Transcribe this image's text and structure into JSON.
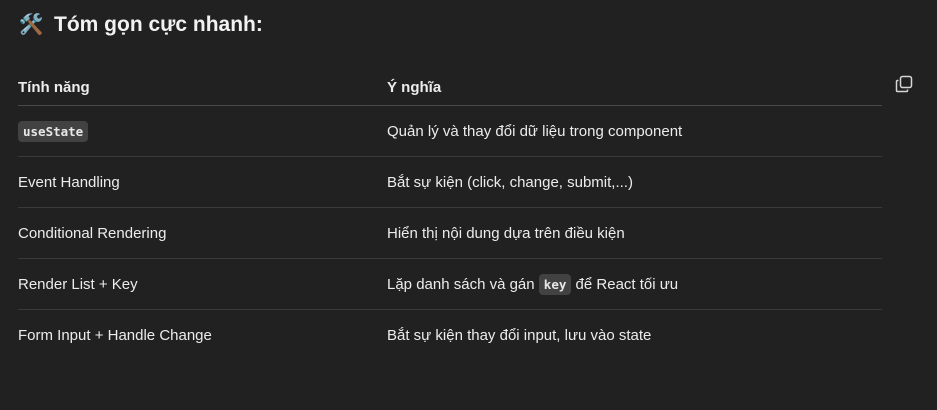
{
  "heading": {
    "emoji": "🛠️",
    "text": "Tóm gọn cực nhanh:"
  },
  "table": {
    "headers": [
      "Tính năng",
      "Ý nghĩa"
    ],
    "rows": [
      {
        "feature_code": "useState",
        "meaning": "Quản lý và thay đổi dữ liệu trong component"
      },
      {
        "feature": "Event Handling",
        "meaning": "Bắt sự kiện (click, change, submit,...)"
      },
      {
        "feature": "Conditional Rendering",
        "meaning": "Hiển thị nội dung dựa trên điều kiện"
      },
      {
        "feature": "Render List + Key",
        "meaning_before": "Lặp danh sách và gán ",
        "meaning_code": "key",
        "meaning_after": " để React tối ưu"
      },
      {
        "feature": "Form Input + Handle Change",
        "meaning": "Bắt sự kiện thay đổi input, lưu vào state"
      }
    ]
  },
  "icons": {
    "copy": "copy-icon",
    "tools": "hammer-wrench-icon"
  }
}
